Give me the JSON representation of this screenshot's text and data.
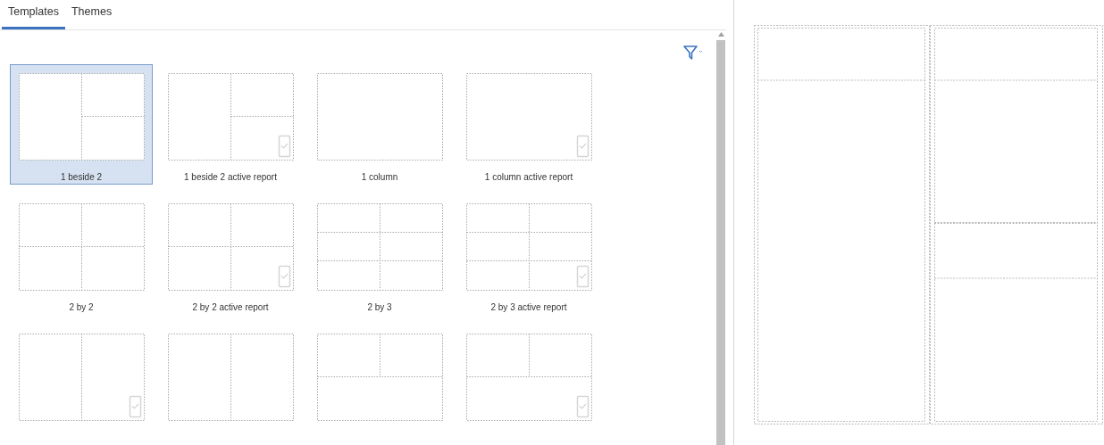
{
  "tabs": [
    {
      "label": "Templates",
      "selected": true
    },
    {
      "label": "Themes",
      "selected": false
    }
  ],
  "templates": [
    {
      "label": "1 beside 2",
      "kind": "beside",
      "active_report": false,
      "selected": true
    },
    {
      "label": "1 beside 2 active report",
      "kind": "beside",
      "active_report": true,
      "selected": false
    },
    {
      "label": "1 column",
      "kind": "single",
      "active_report": false,
      "selected": false
    },
    {
      "label": "1 column active report",
      "kind": "single",
      "active_report": true,
      "selected": false
    },
    {
      "label": "2 by 2",
      "kind": "quad",
      "active_report": false,
      "selected": false
    },
    {
      "label": "2 by 2 active report",
      "kind": "quad",
      "active_report": true,
      "selected": false
    },
    {
      "label": "2 by 3",
      "kind": "sextet",
      "active_report": false,
      "selected": false
    },
    {
      "label": "2 by 3 active report",
      "kind": "sextet",
      "active_report": true,
      "selected": false
    },
    {
      "kind": "halves",
      "active_report": true,
      "selected": false
    },
    {
      "kind": "halves",
      "active_report": false,
      "selected": false
    },
    {
      "kind": "stacked",
      "active_report": false,
      "selected": false
    },
    {
      "kind": "stacked",
      "active_report": true,
      "selected": false
    }
  ]
}
